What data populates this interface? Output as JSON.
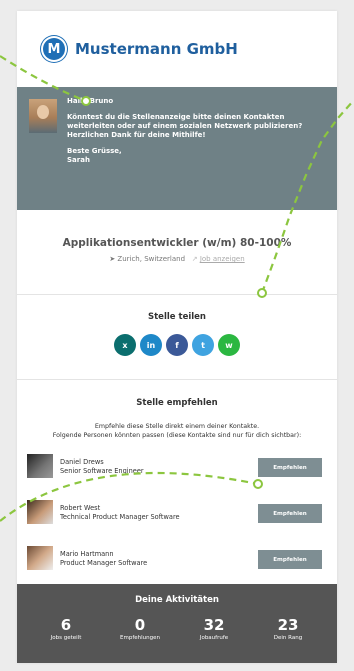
{
  "company": {
    "logo_letter": "M",
    "name": "Mustermann GmbH"
  },
  "message": {
    "greeting": "Hallo Bruno",
    "body1": "Könntest du die Stellenanzeige bitte deinen Kontakten",
    "body2": "weiterleiten oder auf einem sozialen Netzwerk publizieren?",
    "body3": "Herzlichen Dank für deine Mithilfe!",
    "closing": "Beste Grüsse,",
    "signature": "Sarah"
  },
  "job": {
    "title": "Applikationsentwickler (w/m) 80-100%",
    "location": "Zurich, Switzerland",
    "link_label": "Job anzeigen"
  },
  "share": {
    "title": "Stelle teilen",
    "icons": [
      {
        "name": "xing-icon",
        "glyph": "x",
        "color": "#0b6e6e"
      },
      {
        "name": "linkedin-icon",
        "glyph": "in",
        "color": "#1e88c8"
      },
      {
        "name": "facebook-icon",
        "glyph": "f",
        "color": "#3b5998"
      },
      {
        "name": "twitter-icon",
        "glyph": "t",
        "color": "#3fa3e0"
      },
      {
        "name": "whatsapp-icon",
        "glyph": "w",
        "color": "#2bb741"
      }
    ]
  },
  "recommend": {
    "title": "Stelle empfehlen",
    "desc1": "Empfehle diese Stelle direkt einem deiner Kontakte.",
    "desc2": "Folgende Personen könnten passen (diese Kontakte sind nur für dich sichtbar):",
    "button_label": "Empfehlen",
    "people": [
      {
        "name": "Daniel Drews",
        "role": "Senior Software Engineer"
      },
      {
        "name": "Robert West",
        "role": "Technical Product Manager Software"
      },
      {
        "name": "Mario Hartmann",
        "role": "Product Manager Software"
      }
    ]
  },
  "activities": {
    "title": "Deine Aktivitäten",
    "stats": [
      {
        "value": "6",
        "label": "Jobs geteilt"
      },
      {
        "value": "0",
        "label": "Empfehlungen"
      },
      {
        "value": "32",
        "label": "Jobaufrufe"
      },
      {
        "value": "23",
        "label": "Dein Rang"
      }
    ]
  },
  "colors": {
    "brand": "#1f5f9e",
    "accent": "#8cc63f",
    "message_bg": "#6f8186",
    "button_bg": "#7e8e93",
    "activity_bg": "#555555"
  }
}
